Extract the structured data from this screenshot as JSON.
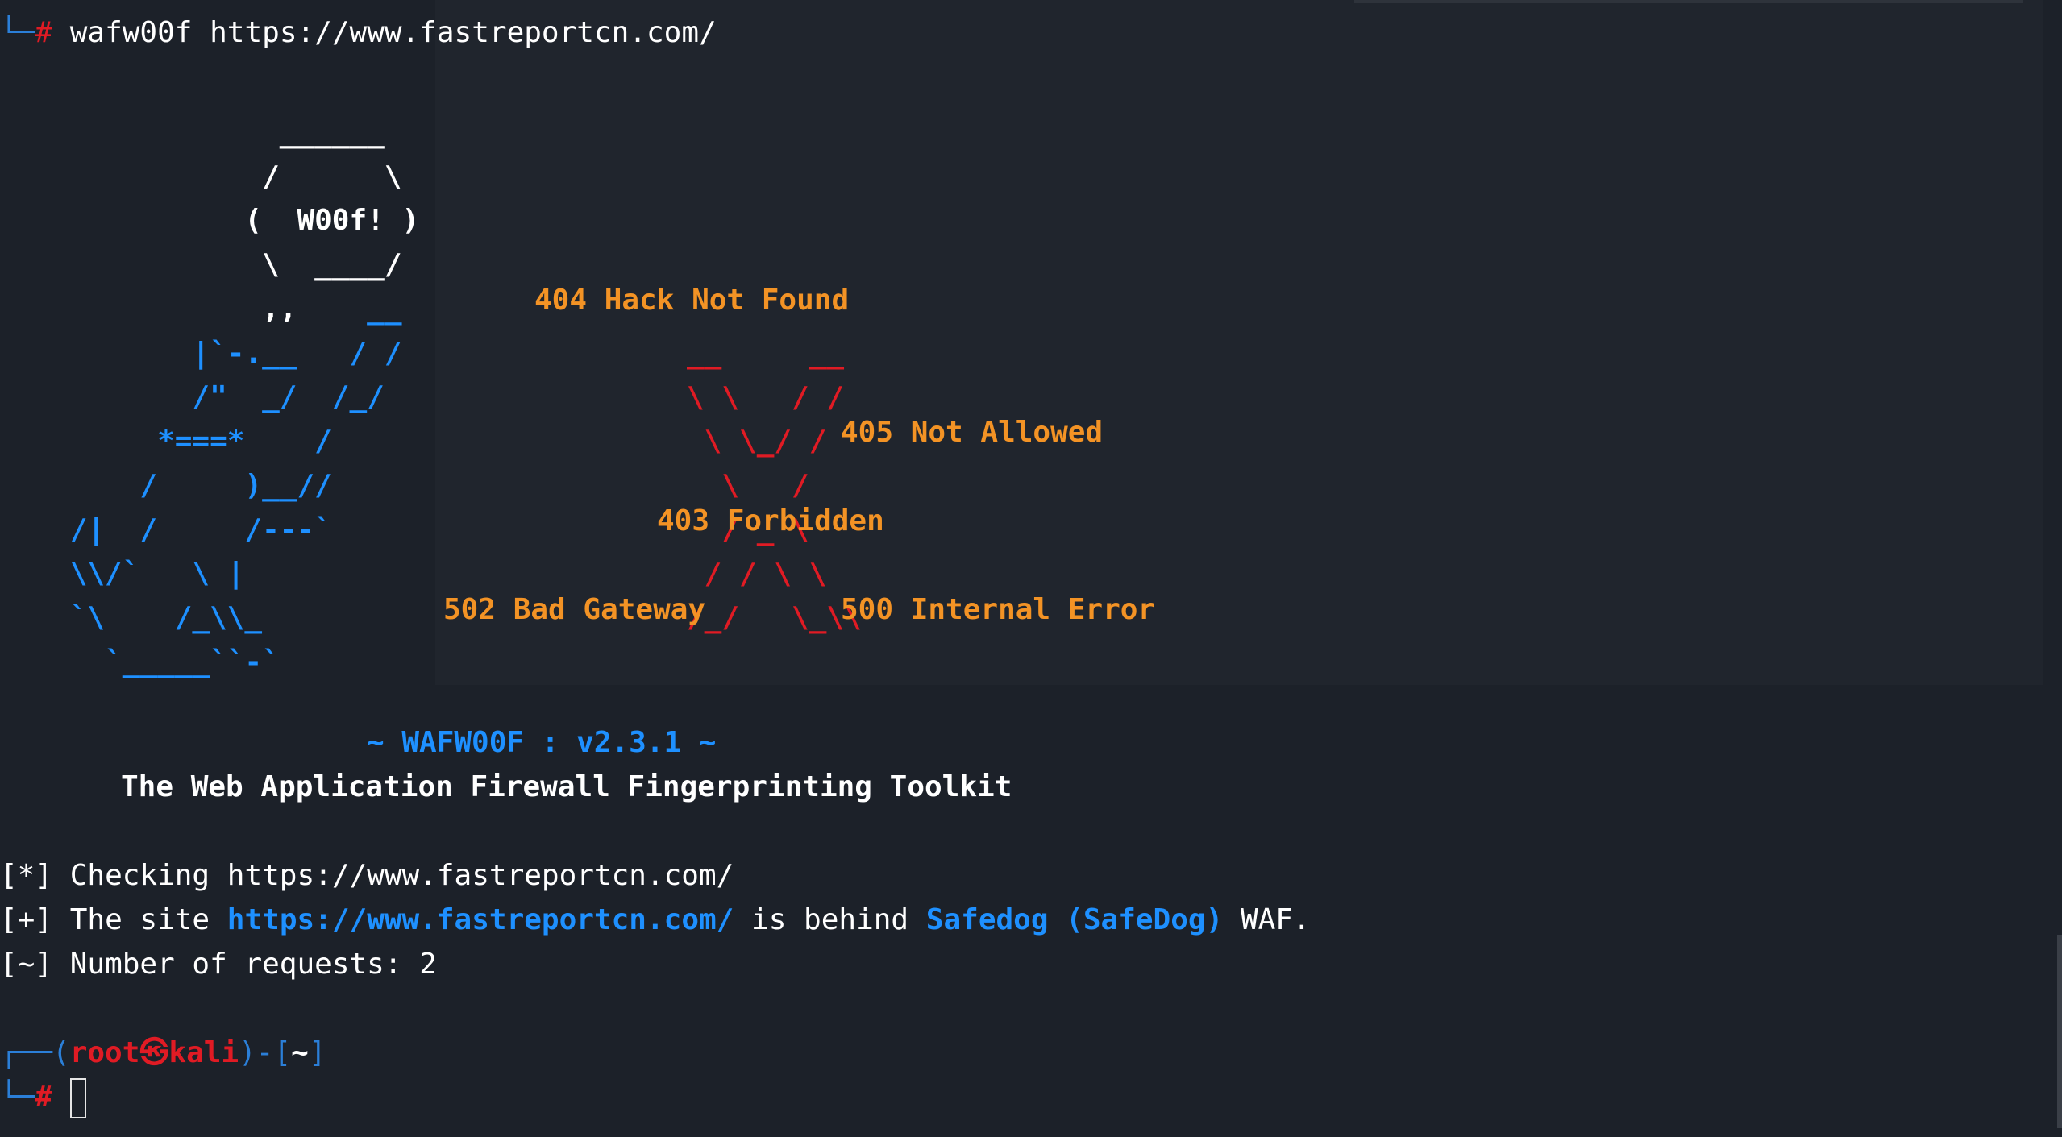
{
  "terminal": {
    "command_line": {
      "prompt_symbol": "#",
      "command": "wafw00f https://www.fastreportcn.com/"
    },
    "banner": {
      "white_art": [
        "                ______",
        "               /      \\",
        "              (  W00f! )",
        "               \\  ____/",
        "               ,,"
      ],
      "blue_art": [
        "                     __",
        "           |`-.__   / /",
        "           /\"  _/  /_/",
        "         *===*    /",
        "        /     )__//",
        "    /|  /     /---`",
        "    \\\\/`   \\ |",
        "    `\\    /_\\\\_",
        "      `_____``-`"
      ],
      "red_art": [
        "__     __",
        "\\ \\   / /",
        " \\ \\_/ /",
        "  \\   /",
        "",
        "  / _ \\",
        " / / \\ \\",
        "/_/   \\_\\\\"
      ],
      "labels": {
        "hack_not_found": "404 Hack Not Found",
        "not_allowed": "405 Not Allowed",
        "forbidden": "403 Forbidden",
        "bad_gateway": "502 Bad Gateway",
        "internal_error": "500 Internal Error"
      },
      "version_line": "~ WAFW00F : v2.3.1 ~",
      "tagline": "The Web Application Firewall Fingerprinting Toolkit"
    },
    "output": {
      "checking": {
        "prefix": "[*]",
        "text": "Checking https://www.fastreportcn.com/"
      },
      "result": {
        "prefix": "[+]",
        "text_before": "The site",
        "url": "https://www.fastreportcn.com/",
        "text_middle": "is behind",
        "waf_name": "Safedog (SafeDog)",
        "text_after": "WAF."
      },
      "requests": {
        "prefix": "[~]",
        "text": "Number of requests: 2"
      }
    },
    "prompt": {
      "user": "root",
      "host_symbol": "㉿",
      "host": "kali",
      "directory": "~",
      "symbol": "#"
    }
  },
  "colors": {
    "background": "#1c2129",
    "accent_blue": "#1e90ff",
    "prompt_red": "#e01b24",
    "status_orange": "#f39325"
  }
}
